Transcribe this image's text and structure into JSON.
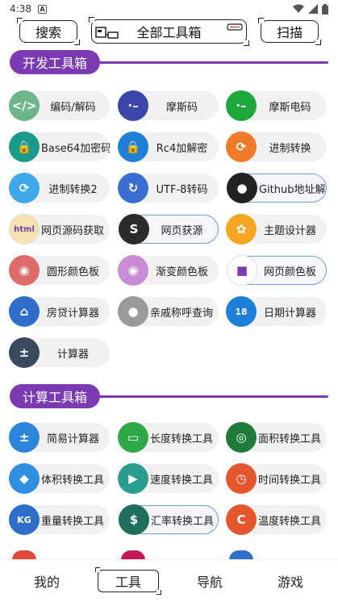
{
  "status": {
    "time": "4:38",
    "notif": "A"
  },
  "topbar": {
    "search": "搜索",
    "title": "全部工具箱",
    "scan": "扫描"
  },
  "sections": [
    {
      "title": "开发工具箱",
      "items": [
        {
          "label": "编码/解码",
          "icon": "code-icon",
          "color": "#6fb58a"
        },
        {
          "label": "摩斯码",
          "icon": "dot-dash-icon",
          "color": "#3b47a8"
        },
        {
          "label": "摩斯电码",
          "icon": "dot-dash-icon",
          "color": "#1ea83b"
        },
        {
          "label": "Base64加密码",
          "icon": "lock-icon",
          "color": "#1a9a8a"
        },
        {
          "label": "Rc4加解密",
          "icon": "lock-icon",
          "color": "#1e7fd6"
        },
        {
          "label": "进制转换",
          "icon": "refresh-icon",
          "color": "#f07b2a"
        },
        {
          "label": "进制转换2",
          "icon": "refresh-icon",
          "color": "#3ea8e8"
        },
        {
          "label": "UTF-8转码",
          "icon": "cycle-icon",
          "color": "#3a6fd1"
        },
        {
          "label": "Github地址解...",
          "icon": "github-icon",
          "color": "#222222"
        },
        {
          "label": "网页源码获取",
          "icon": "html-icon",
          "color": "#f4e3b0"
        },
        {
          "label": "网页获源",
          "icon": "s-logo-icon",
          "color": "#2b2b2b"
        },
        {
          "label": "主题设计器",
          "icon": "palette-icon",
          "color": "#f5a623"
        },
        {
          "label": "圆形颜色板",
          "icon": "color-wheel-icon",
          "color": "#e06b6b"
        },
        {
          "label": "渐变颜色板",
          "icon": "color-wheel-icon",
          "color": "#c98ad6"
        },
        {
          "label": "网页颜色板",
          "icon": "gradient-square-icon",
          "color": "#ffffff"
        },
        {
          "label": "房贷计算器",
          "icon": "house-icon",
          "color": "#2f6fc9"
        },
        {
          "label": "亲戚称呼查询",
          "icon": "person-icon",
          "color": "#9a9a9a"
        },
        {
          "label": "日期计算器",
          "icon": "calendar-icon",
          "color": "#1e7fd6"
        },
        {
          "label": "计算器",
          "icon": "calculator-icon",
          "color": "#3a4a5e"
        }
      ]
    },
    {
      "title": "计算工具箱",
      "items": [
        {
          "label": "简易计算器",
          "icon": "calculator-icon",
          "color": "#2b87de"
        },
        {
          "label": "长度转换工具",
          "icon": "ruler-icon",
          "color": "#2fa84a"
        },
        {
          "label": "面积转换工具",
          "icon": "radar-icon",
          "color": "#1f7a3c"
        },
        {
          "label": "体积转换工具",
          "icon": "box-icon",
          "color": "#2f8fe0"
        },
        {
          "label": "速度转换工具",
          "icon": "truck-icon",
          "color": "#2a9d8f"
        },
        {
          "label": "时间转换工具",
          "icon": "clock-icon",
          "color": "#e4572e"
        },
        {
          "label": "重量转换工具",
          "icon": "weight-icon",
          "color": "#2f6fc9"
        },
        {
          "label": "汇率转换工具",
          "icon": "money-icon",
          "color": "#1f6f5c"
        },
        {
          "label": "温度转换工具",
          "icon": "thermometer-icon",
          "color": "#e4572e"
        }
      ]
    }
  ],
  "nav": {
    "mine": "我的",
    "tools": "工具",
    "guide": "导航",
    "games": "游戏"
  }
}
